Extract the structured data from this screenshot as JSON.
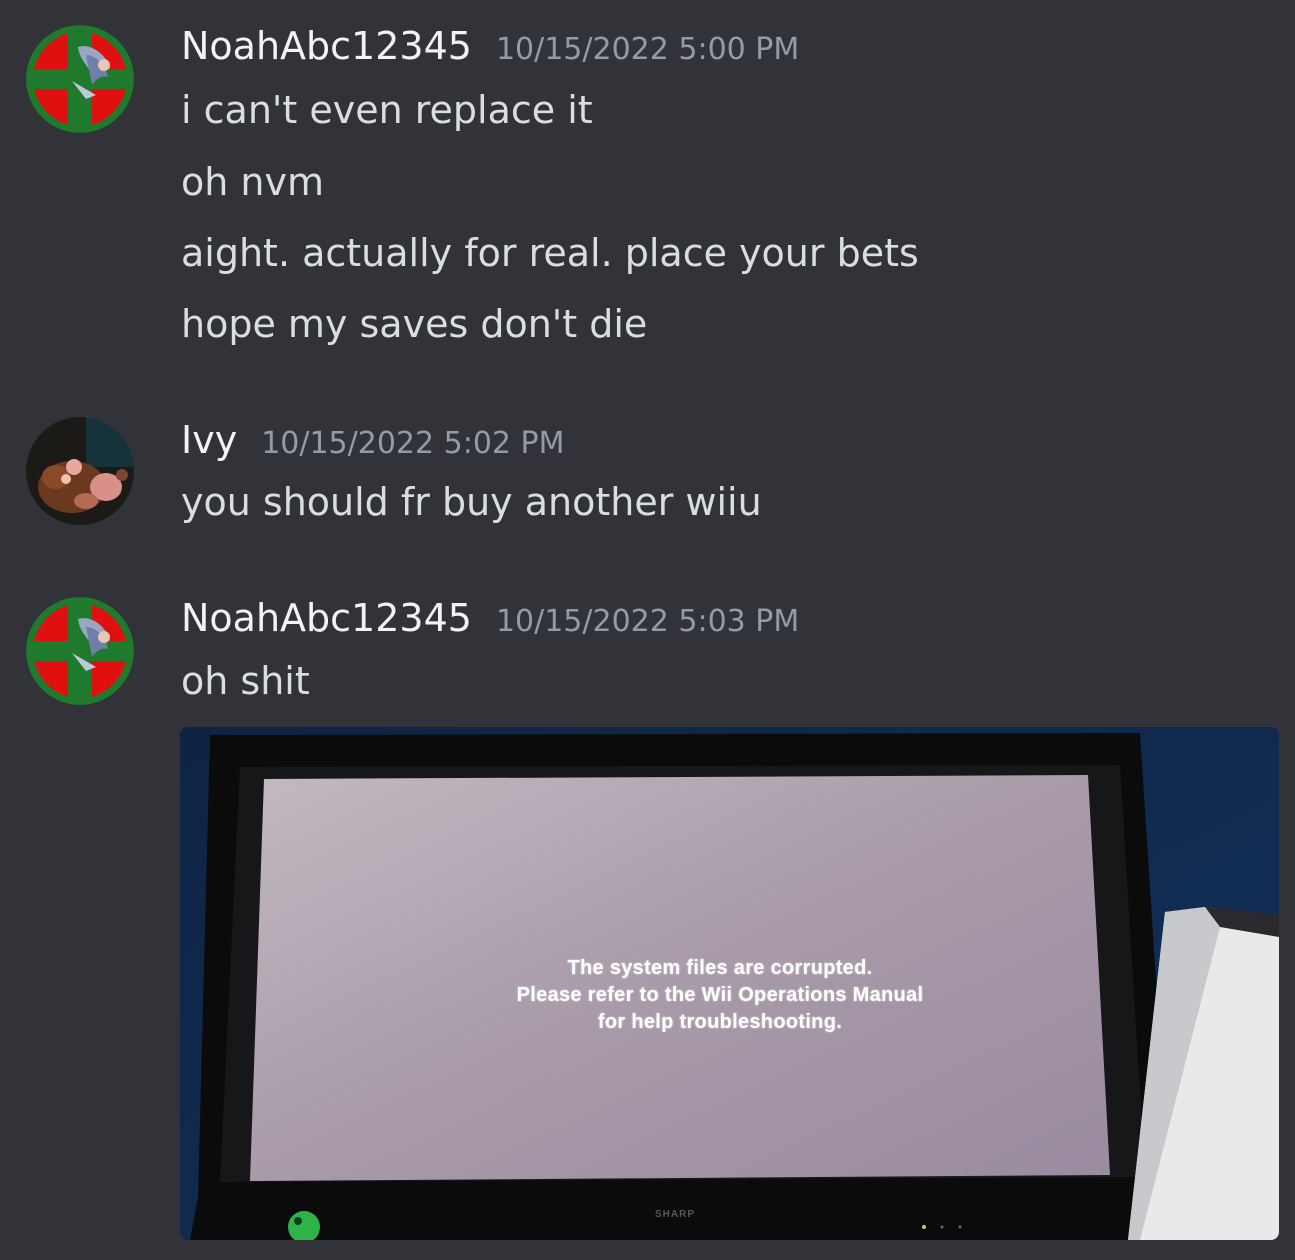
{
  "groups": [
    {
      "username": "NoahAbc12345",
      "timestamp": "10/15/2022 5:00 PM",
      "avatar_icon": "smash-ball-avatar",
      "messages": [
        "i can't even replace it",
        "oh nvm",
        "aight. actually for real. place your bets",
        "hope my saves don't die"
      ]
    },
    {
      "username": "Ivy",
      "timestamp": "10/15/2022 5:02 PM",
      "avatar_icon": "photo-avatar",
      "messages": [
        "you should fr buy another wiiu"
      ]
    },
    {
      "username": "NoahAbc12345",
      "timestamp": "10/15/2022 5:03 PM",
      "avatar_icon": "smash-ball-avatar",
      "messages": [
        "oh shit"
      ],
      "attachment": {
        "screen_lines": [
          "The system files are corrupted.",
          "Please refer to the Wii Operations Manual",
          "for help troubleshooting."
        ],
        "tv_brand": "SHARP"
      }
    }
  ],
  "colors": {
    "background": "#313338",
    "username": "#f2f3f5",
    "timestamp": "#949ba4",
    "message_text": "#dbdee1"
  }
}
